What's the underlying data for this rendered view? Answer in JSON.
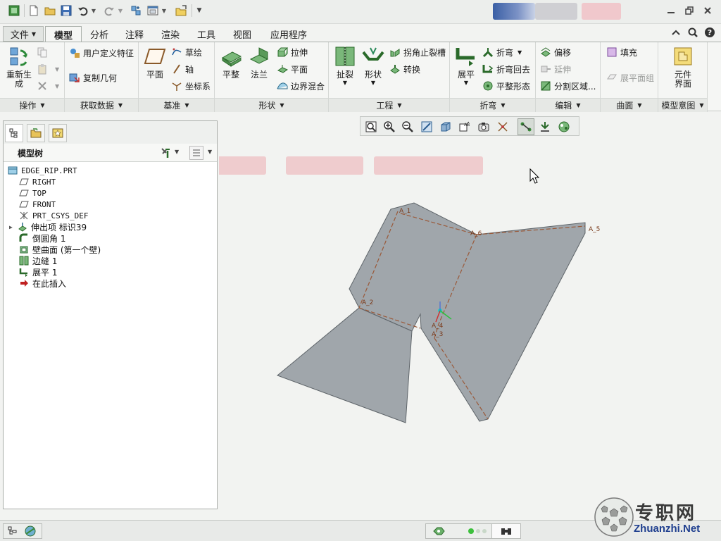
{
  "ribbon": {
    "tabs": [
      {
        "label": "文件",
        "has_dropdown": true
      },
      {
        "label": "模型",
        "active": true
      },
      {
        "label": "分析"
      },
      {
        "label": "注释"
      },
      {
        "label": "渲染"
      },
      {
        "label": "工具"
      },
      {
        "label": "视图"
      },
      {
        "label": "应用程序"
      }
    ],
    "groups": {
      "operations": {
        "footer": "操作",
        "regenerate": "重新生\n成"
      },
      "get_data": {
        "footer": "获取数据",
        "user_defined_feature": "用户定义特征",
        "copy_geometry": "复制几何"
      },
      "datum": {
        "footer": "基准",
        "plane": "平面",
        "sketch": "草绘",
        "axis": "轴",
        "csys": "坐标系"
      },
      "shapes": {
        "footer": "形状",
        "planar": "平整",
        "flange": "法兰",
        "extrude": "拉伸",
        "flat": "平面",
        "boundary_blend": "边界混合"
      },
      "engineering": {
        "footer": "工程",
        "rip": "扯裂",
        "form": "形状",
        "corner_relief": "拐角止裂槽",
        "convert": "转换"
      },
      "bends": {
        "footer": "折弯",
        "unbend": "展平",
        "bend": "折弯",
        "bend_back": "折弯回去",
        "flatten_form": "平整形态"
      },
      "editing": {
        "footer": "编辑",
        "offset": "偏移",
        "extend": "延伸",
        "split_area": "分割区域..."
      },
      "surfaces": {
        "footer": "曲面",
        "fill": "填充",
        "flat_pattern": "展平面组"
      },
      "model_intent": {
        "footer": "模型意图",
        "component_interface": "元件\n界面"
      }
    }
  },
  "model_tree": {
    "title": "模型树",
    "items": [
      {
        "label": "EDGE_RIP.PRT",
        "icon": "part-icon",
        "level": 0
      },
      {
        "label": "RIGHT",
        "icon": "datum-plane-icon",
        "level": 1
      },
      {
        "label": "TOP",
        "icon": "datum-plane-icon",
        "level": 1
      },
      {
        "label": "FRONT",
        "icon": "datum-plane-icon",
        "level": 1
      },
      {
        "label": "PRT_CSYS_DEF",
        "icon": "csys-icon",
        "level": 1
      },
      {
        "label": "伸出项 标识39",
        "icon": "protrusion-icon",
        "level": 1,
        "expandable": true
      },
      {
        "label": "倒圆角 1",
        "icon": "round-icon",
        "level": 1
      },
      {
        "label": "壁曲面 (第一个壁)",
        "icon": "wall-icon",
        "level": 1
      },
      {
        "label": "边缝 1",
        "icon": "edge-rip-icon",
        "level": 1
      },
      {
        "label": "展平 1",
        "icon": "unbend-icon",
        "level": 1
      },
      {
        "label": "在此插入",
        "icon": "insert-here-icon",
        "level": 1
      }
    ]
  },
  "graphics": {
    "datum_axis_labels": [
      "A_1",
      "A_2",
      "A_3",
      "A_4",
      "A_5",
      "A_6"
    ],
    "part_color": "#a0a6ab",
    "part_edge_color": "#5e6469",
    "dashed_color": "#9a5a3a"
  },
  "watermark": {
    "main": "专职网",
    "sub": "Zhuanzhi.Net"
  },
  "colors": {
    "accent_green": "#3a9a3a",
    "background": "#f2f3f1"
  }
}
